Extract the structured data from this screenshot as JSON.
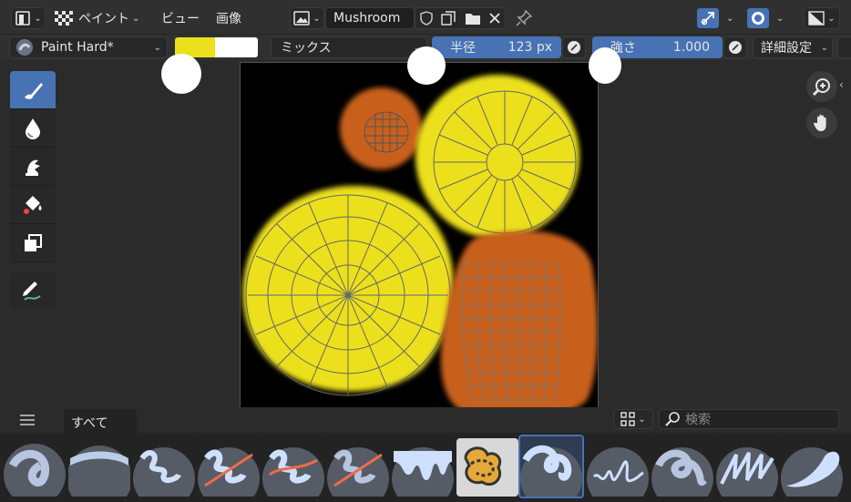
{
  "header": {
    "paint_mode_label": "ペイント",
    "menu_view": "ビュー",
    "menu_image": "画像",
    "image_name": "Mushroom"
  },
  "toolsettings": {
    "brush_name": "Paint Hard*",
    "blend_mode": "ミックス",
    "radius_label": "半径",
    "radius_value": "123 px",
    "strength_label": "強さ",
    "strength_value": "1.000",
    "advanced_label": "詳細設定",
    "primary_color": "#ece01c",
    "secondary_color": "#ffffff"
  },
  "shelf": {
    "tab_all": "すべて",
    "search_placeholder": "検索"
  },
  "colors": {
    "accent": "#4772b3",
    "yellow": "#ece01c",
    "orange": "#c8601e"
  },
  "tools": [
    "brush-tool",
    "blur-tool",
    "smear-tool",
    "fill-tool",
    "clone-tool",
    "annotate-tool"
  ],
  "brush_presets": [
    "Airbrush",
    "Paint Soft",
    "Paint Textured",
    "Eraser Hard",
    "Eraser Soft",
    "Eraser Textured",
    "Drips",
    "Pattern",
    "Paint Hard",
    "Squiggle",
    "Paint Blend",
    "Paint Hatch",
    "Smear"
  ]
}
